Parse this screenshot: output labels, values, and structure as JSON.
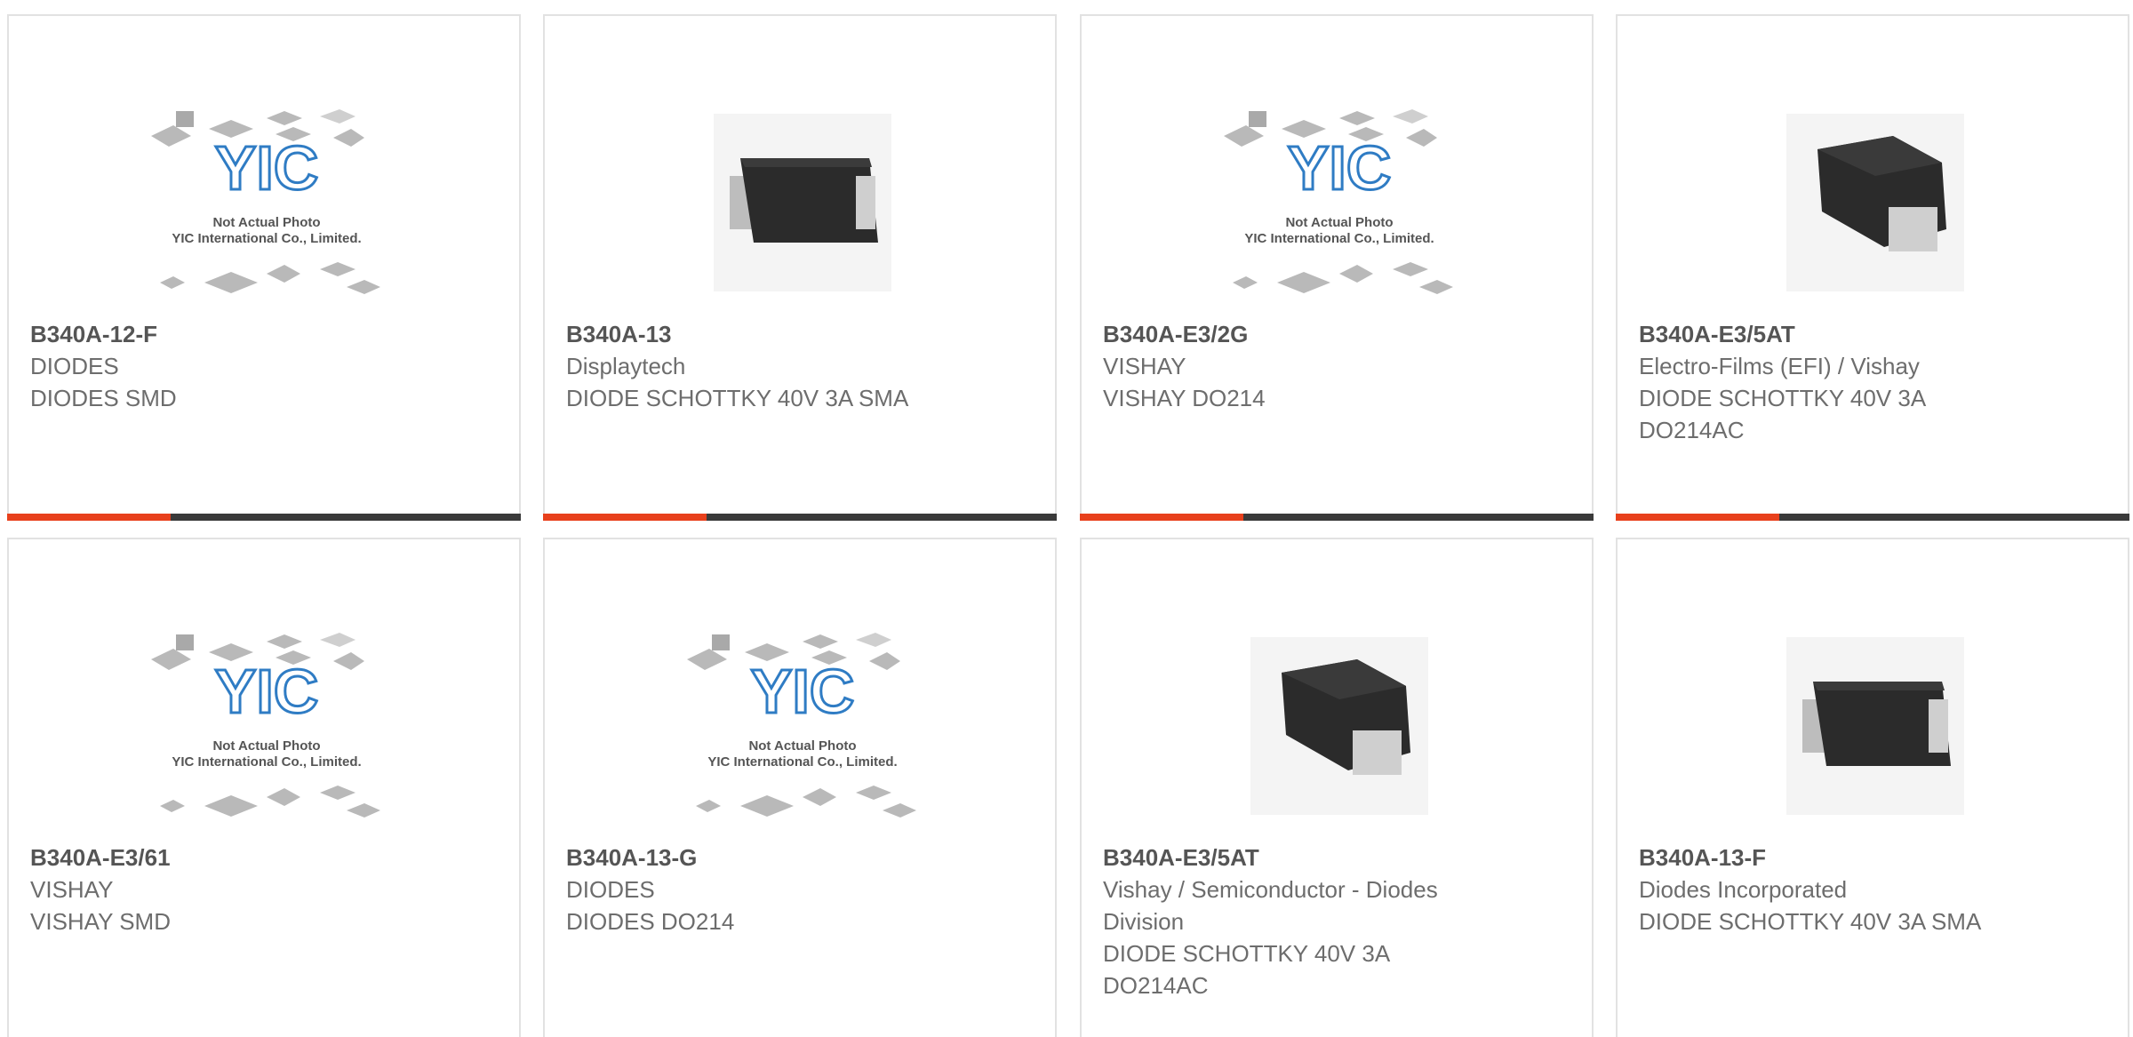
{
  "placeholder": {
    "line1": "Not Actual Photo",
    "line2": "YIC International Co., Limited.",
    "logo": "YIC"
  },
  "cards": [
    {
      "part": "B340A-12-F",
      "mfr": "DIODES",
      "desc": "DIODES SMD",
      "image": "placeholder",
      "has_bar": true
    },
    {
      "part": "B340A-13",
      "mfr": "Displaytech",
      "desc": "DIODE SCHOTTKY 40V 3A SMA",
      "image": "sma-side",
      "has_bar": true
    },
    {
      "part": "B340A-E3/2G",
      "mfr": "VISHAY",
      "desc": "VISHAY DO214",
      "image": "placeholder",
      "has_bar": true
    },
    {
      "part": "B340A-E3/5AT",
      "mfr": "Electro-Films (EFI) / Vishay",
      "desc": "DIODE SCHOTTKY 40V 3A DO214AC",
      "image": "sma-end",
      "has_bar": true
    },
    {
      "part": "B340A-E3/61",
      "mfr": "VISHAY",
      "desc": "VISHAY SMD",
      "image": "placeholder",
      "has_bar": false
    },
    {
      "part": "B340A-13-G",
      "mfr": "DIODES",
      "desc": "DIODES DO214",
      "image": "placeholder",
      "has_bar": false
    },
    {
      "part": "B340A-E3/5AT",
      "mfr": "Vishay / Semiconductor - Diodes Division",
      "desc": "DIODE SCHOTTKY 40V 3A DO214AC",
      "image": "sma-end",
      "has_bar": false
    },
    {
      "part": "B340A-13-F",
      "mfr": "Diodes Incorporated",
      "desc": "DIODE SCHOTTKY 40V 3A SMA",
      "image": "sma-side",
      "has_bar": false
    }
  ],
  "colors": {
    "accent": "#e8401c",
    "bar": "#3a3a3a",
    "border": "#e2e2e2",
    "text": "#6d6d6d"
  }
}
